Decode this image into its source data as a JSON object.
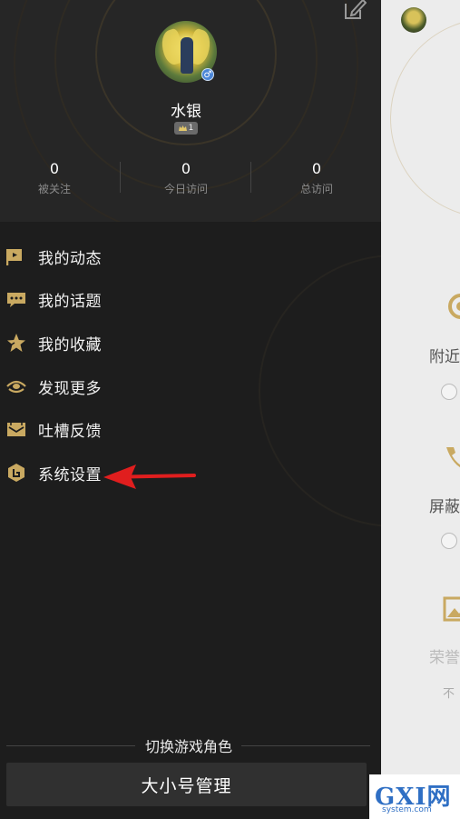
{
  "profile": {
    "username": "水银",
    "level": "1",
    "gender_icon": "male-icon",
    "stats": [
      {
        "value": "0",
        "label": "被关注"
      },
      {
        "value": "0",
        "label": "今日访问"
      },
      {
        "value": "0",
        "label": "总访问"
      }
    ]
  },
  "menu": {
    "items": [
      {
        "label": "我的动态",
        "icon": "flag-icon"
      },
      {
        "label": "我的话题",
        "icon": "chat-bubble-icon"
      },
      {
        "label": "我的收藏",
        "icon": "star-icon"
      },
      {
        "label": "发现更多",
        "icon": "eye-icon"
      },
      {
        "label": "吐槽反馈",
        "icon": "mail-icon"
      },
      {
        "label": "系统设置",
        "icon": "settings-icon"
      }
    ]
  },
  "footer": {
    "switch_label": "切换游戏角色",
    "manage_button": "大小号管理"
  },
  "background_page": {
    "labels": [
      "附近",
      "屏蔽",
      "荣誉"
    ],
    "small_text": "不"
  },
  "watermark": {
    "brand": "GXI网",
    "site": "system.com"
  },
  "colors": {
    "accent_gold": "#c9a961",
    "drawer_bg": "#1d1d1d",
    "arrow_red": "#e01e1e",
    "gender_blue": "#4b86d8"
  }
}
